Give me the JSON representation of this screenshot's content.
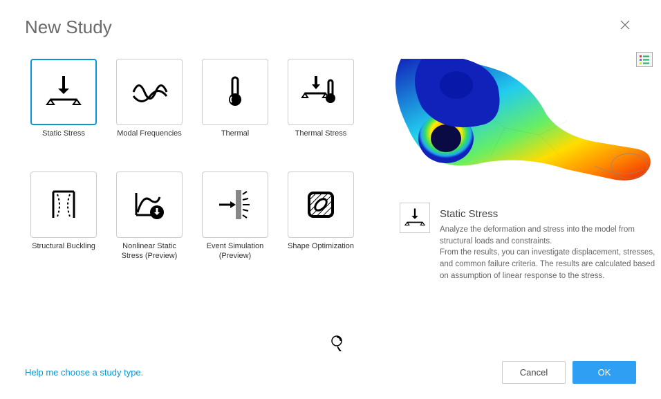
{
  "header": {
    "title": "New Study"
  },
  "studies": [
    {
      "label": "Static Stress",
      "selected": true
    },
    {
      "label": "Modal Frequencies",
      "selected": false
    },
    {
      "label": "Thermal",
      "selected": false
    },
    {
      "label": "Thermal Stress",
      "selected": false
    },
    {
      "label": "Structural Buckling",
      "selected": false
    },
    {
      "label": "Nonlinear Static Stress (Preview)",
      "selected": false
    },
    {
      "label": "Event Simulation (Preview)",
      "selected": false
    },
    {
      "label": "Shape Optimization",
      "selected": false
    }
  ],
  "detail": {
    "title": "Static Stress",
    "description": "Analyze the deformation and stress into the model from structural loads and constraints.\nFrom the results, you can investigate displacement, stresses, and common failure criteria. The results are calculated based on assumption of linear response to the stress."
  },
  "footer": {
    "help_link": "Help me choose a study type.",
    "cancel": "Cancel",
    "ok": "OK"
  },
  "colors": {
    "accent": "#0696d7",
    "ok_button": "#2e9ff2"
  }
}
